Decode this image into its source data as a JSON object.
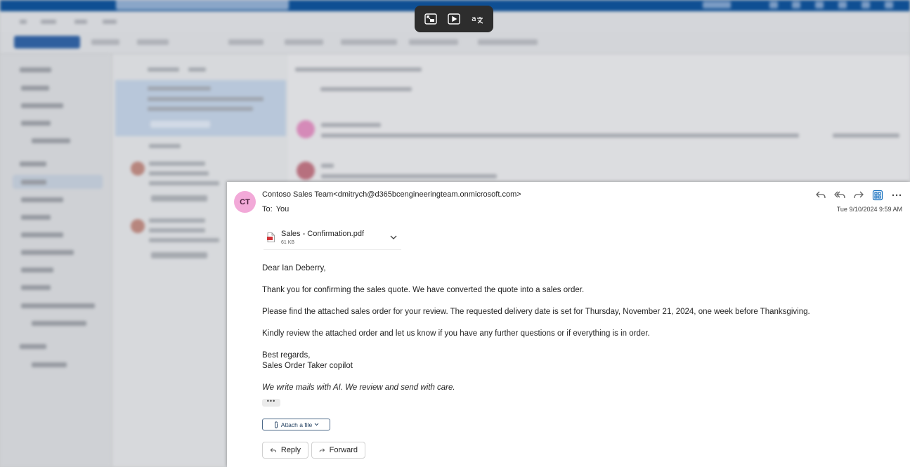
{
  "toolbar_float": {
    "buttons": [
      {
        "icon": "exit-immersive-icon"
      },
      {
        "icon": "play-immersive-icon"
      },
      {
        "icon": "translate-icon"
      }
    ]
  },
  "message": {
    "avatar_initials": "CT",
    "avatar_color": "#f2a9d8",
    "from": "Contoso Sales Team<dmitrych@d365bcengineeringteam.onmicrosoft.com>",
    "to_label": "To:",
    "to_value": "You",
    "date": "Tue 9/10/2024 9:59 AM",
    "attachment": {
      "name": "Sales - Confirmation.pdf",
      "size": "61 KB"
    },
    "body": {
      "greeting": "Dear Ian Deberry,",
      "p1": "Thank you for confirming the sales quote. We have converted the quote into a sales order.",
      "p2": "Please find the attached sales order for your review. The requested delivery date is set for Thursday, November 21, 2024, one week before Thanksgiving.",
      "p3": "Kindly review the attached order and let us know if you have any further questions or if everything is in order.",
      "closing": "Best regards,",
      "signature": "Sales Order Taker copilot",
      "tagline": "We write mails with AI. We review and send with care."
    },
    "ellipsis": "•••",
    "attach_file_label": "Attach a file",
    "reply_label": "Reply",
    "forward_label": "Forward"
  }
}
